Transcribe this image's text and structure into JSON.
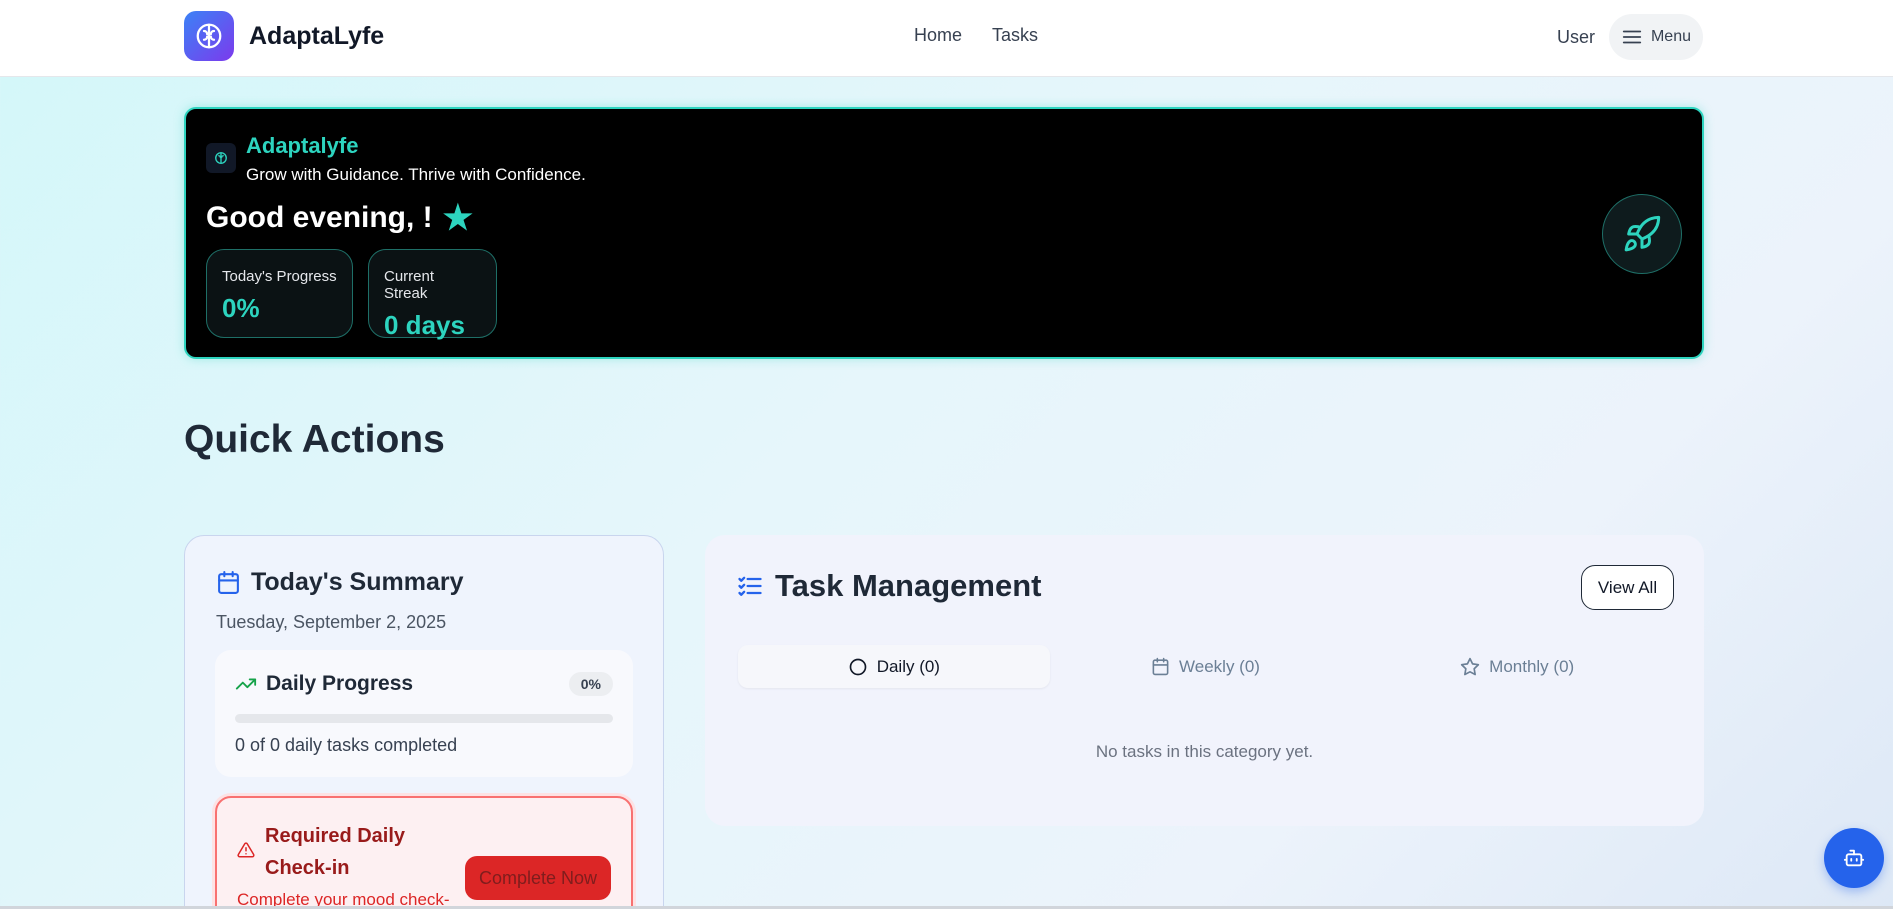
{
  "header": {
    "app_name": "AdaptaLyfe",
    "nav": {
      "home": "Home",
      "tasks": "Tasks"
    },
    "user_label": "User",
    "menu_label": "Menu"
  },
  "hero": {
    "title": "Adaptalyfe",
    "tagline": "Grow with Guidance. Thrive with Confidence.",
    "greeting": "Good evening, !",
    "stats": [
      {
        "label": "Today's Progress",
        "value": "0%"
      },
      {
        "label": "Current Streak",
        "value": "0 days"
      }
    ]
  },
  "quick_actions": {
    "title": "Quick Actions"
  },
  "summary": {
    "title": "Today's Summary",
    "date": "Tuesday, September 2, 2025",
    "progress": {
      "title": "Daily Progress",
      "badge": "0%",
      "fraction": 0,
      "text": "0 of 0 daily tasks completed"
    },
    "checkin": {
      "title": "Required Daily Check-in",
      "description": "Complete your mood check-",
      "button": "Complete Now"
    }
  },
  "tasks": {
    "title": "Task Management",
    "view_all": "View All",
    "tabs": [
      {
        "label": "Daily (0)",
        "icon": "circle-icon",
        "active": true
      },
      {
        "label": "Weekly (0)",
        "icon": "calendar-icon",
        "active": false
      },
      {
        "label": "Monthly (0)",
        "icon": "star-icon",
        "active": false
      }
    ],
    "empty": "No tasks in this category yet."
  },
  "colors": {
    "accent_teal": "#2dd4bf",
    "primary_blue": "#2563eb",
    "alert_red": "#dc2626"
  }
}
